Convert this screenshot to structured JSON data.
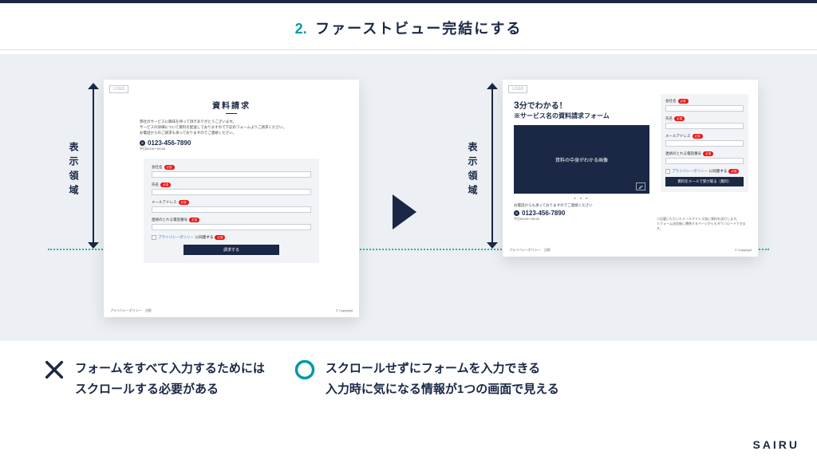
{
  "title": {
    "num": "2.",
    "text": "ファーストビュー完結にする"
  },
  "vlabel": "表示領域",
  "mockA": {
    "logo": "LOGO",
    "heading": "資料請求",
    "para1": "弊社のサービスに興味を持って頂きありがとうございます。",
    "para2": "サービスの詳細について資料を配送しておりますので下記のフォームよりご請求ください。",
    "para3": "お電話からのご請求も承っておりますのでご連絡ください。",
    "phone": "0123-456-7890",
    "hours": "平日00:00〜00:00",
    "f_company": "会社名",
    "f_name": "氏名",
    "f_email": "メールアドレス",
    "f_tel": "連絡のとれる電話番号",
    "req": "必須",
    "privacy_link": "プライバシーポリシー",
    "privacy_suffix": "に同意する",
    "submit": "請求する",
    "foot_pp": "プライバシーポリシー",
    "foot_law": "注釈",
    "foot_copy": "© Copyright"
  },
  "mockB": {
    "logo": "LOGO",
    "h1_big": "3",
    "h1": "分でわかる！",
    "h2": "※サービス名の資料請求フォーム",
    "img_caption": "資料の中身がわかる画像",
    "contact_p": "お電話からも承っておりますのでご連絡ください",
    "phone": "0123-456-7890",
    "hours": "平日00:00〜00:00",
    "submit": "資料をメールで受け取る（無料）",
    "note1": "※記載いただいたメールアドレス宛に資料を送付します。",
    "note2": "※フォーム送信後に遷移するページからもダウンロードできます。",
    "foot_pp": "プライバシーポリシー",
    "foot_law": "注釈",
    "foot_copy": "© Copyright"
  },
  "bad": {
    "l1": "フォームをすべて入力するためには",
    "l2": "スクロールする必要がある"
  },
  "good": {
    "l1": "スクロールせずにフォームを入力できる",
    "l2": "入力時に気になる情報が1つの画面で見える"
  },
  "brand": "SAIRU"
}
